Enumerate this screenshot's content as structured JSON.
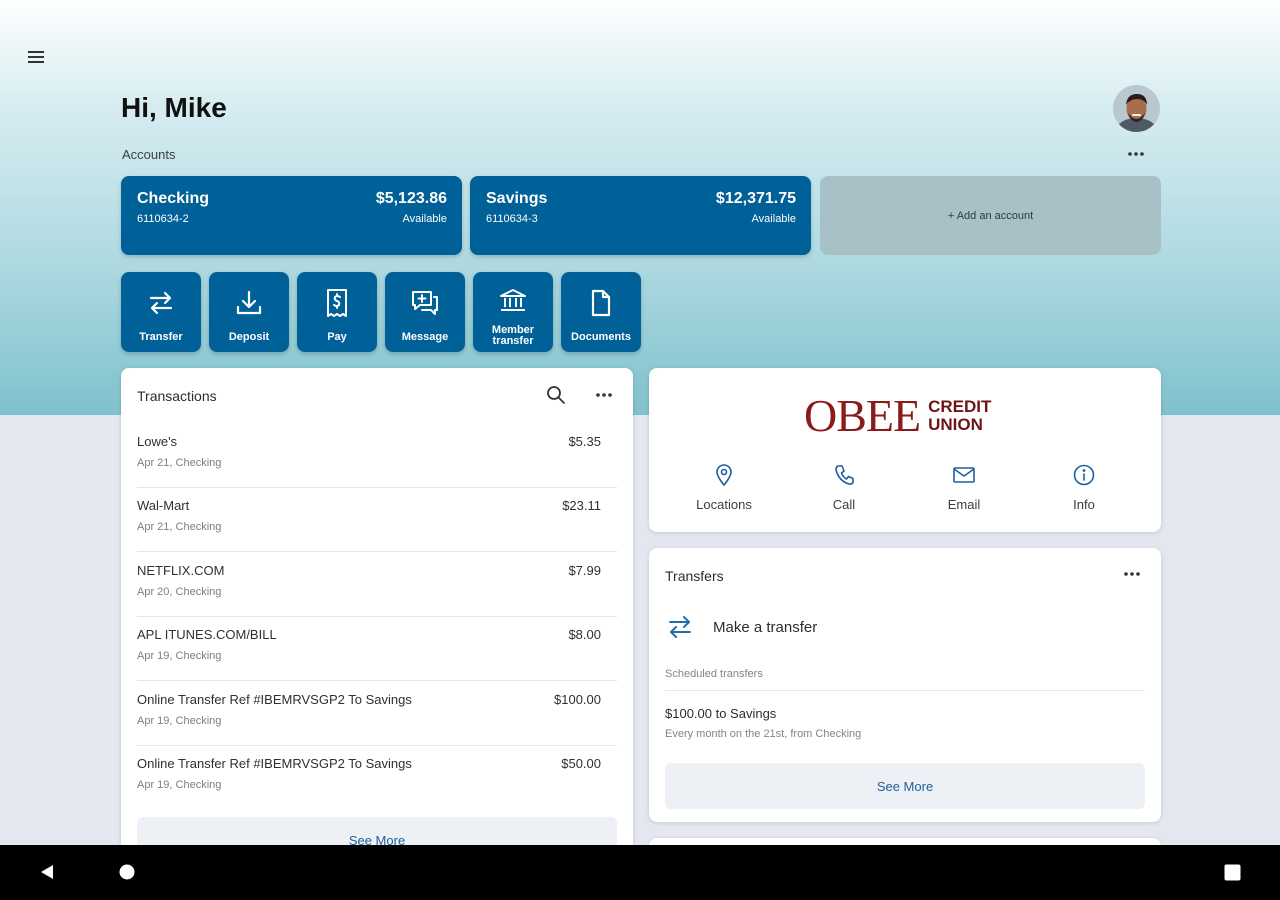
{
  "header": {
    "greeting": "Hi, Mike",
    "accounts_label": "Accounts"
  },
  "accounts": [
    {
      "name": "Checking",
      "number": "6110634-2",
      "balance": "$5,123.86",
      "status": "Available"
    },
    {
      "name": "Savings",
      "number": "6110634-3",
      "balance": "$12,371.75",
      "status": "Available"
    }
  ],
  "add_account_label": "+ Add an account",
  "actions": [
    {
      "label": "Transfer",
      "icon": "transfer-icon"
    },
    {
      "label": "Deposit",
      "icon": "download-icon"
    },
    {
      "label": "Pay",
      "icon": "bill-icon"
    },
    {
      "label": "Message",
      "icon": "message-icon"
    },
    {
      "label": "Member transfer",
      "icon": "bank-icon"
    },
    {
      "label": "Documents",
      "icon": "document-icon"
    }
  ],
  "transactions": {
    "title": "Transactions",
    "items": [
      {
        "desc": "Lowe's",
        "amount": "$5.35",
        "sub": "Apr 21, Checking"
      },
      {
        "desc": "Wal-Mart",
        "amount": "$23.11",
        "sub": "Apr 21, Checking"
      },
      {
        "desc": "NETFLIX.COM",
        "amount": "$7.99",
        "sub": "Apr 20, Checking"
      },
      {
        "desc": "APL ITUNES.COM/BILL",
        "amount": "$8.00",
        "sub": "Apr 19, Checking"
      },
      {
        "desc": "Online Transfer Ref #IBEMRVSGP2 To Savings",
        "amount": "$100.00",
        "sub": "Apr 19, Checking"
      },
      {
        "desc": "Online Transfer Ref #IBEMRVSGP2 To Savings",
        "amount": "$50.00",
        "sub": "Apr 19, Checking"
      }
    ],
    "see_more": "See More"
  },
  "brand": {
    "name": "OBEE",
    "line1": "CREDIT",
    "line2": "UNION",
    "color": "#8b1a1a"
  },
  "quick_links": [
    {
      "label": "Locations",
      "icon": "location-pin-icon"
    },
    {
      "label": "Call",
      "icon": "phone-icon"
    },
    {
      "label": "Email",
      "icon": "email-icon"
    },
    {
      "label": "Info",
      "icon": "info-icon"
    }
  ],
  "transfers": {
    "title": "Transfers",
    "make_label": "Make a transfer",
    "scheduled_label": "Scheduled transfers",
    "scheduled": [
      {
        "title": "$100.00 to Savings",
        "sub": "Every month on the 21st, from Checking"
      }
    ],
    "see_more": "See More"
  },
  "colors": {
    "primary": "#006098",
    "add_card": "#a8c1c6",
    "link": "#1f5f9a"
  }
}
